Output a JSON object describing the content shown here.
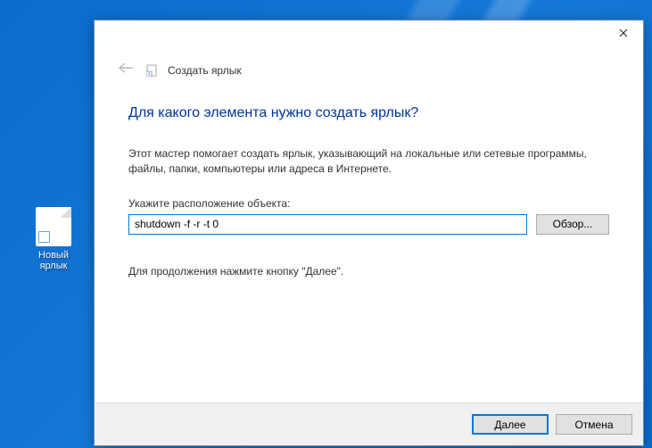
{
  "desktop": {
    "icon_label": "Новый ярлык"
  },
  "dialog": {
    "breadcrumb": "Создать ярлык",
    "title": "Для какого элемента нужно создать ярлык?",
    "description": "Этот мастер помогает создать ярлык, указывающий на локальные или сетевые программы, файлы, папки, компьютеры или адреса в Интернете.",
    "field_label": "Укажите расположение объекта:",
    "location_value": "shutdown -f -r -t 0",
    "browse_label": "Обзор...",
    "continue_text": "Для продолжения нажмите кнопку \"Далее\".",
    "next_label": "Далее",
    "cancel_label": "Отмена"
  }
}
